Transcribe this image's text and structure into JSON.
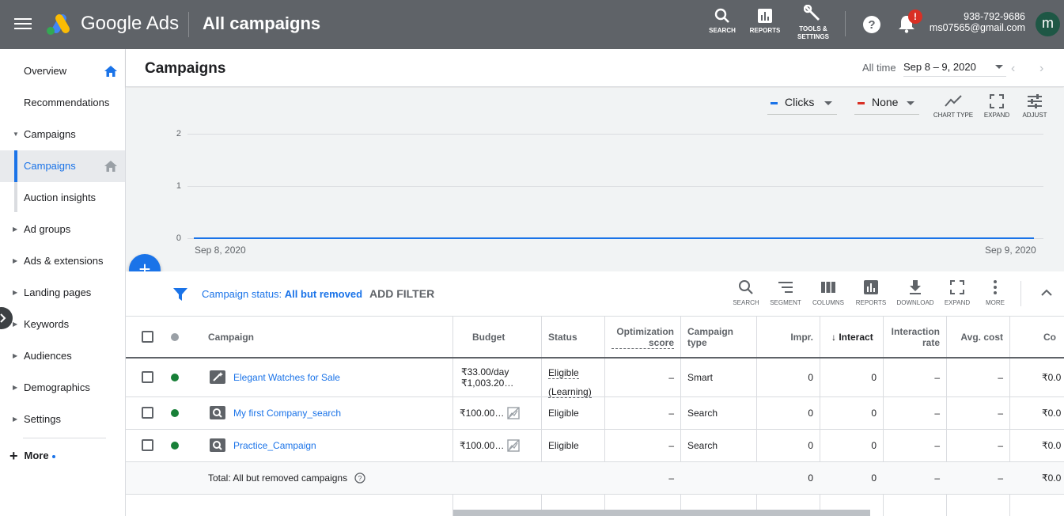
{
  "topbar": {
    "brand": "Google Ads",
    "page_title": "All campaigns",
    "tools": {
      "search": "SEARCH",
      "reports": "REPORTS",
      "tools_line1": "TOOLS &",
      "tools_line2": "SETTINGS"
    },
    "notification_badge": "!",
    "account_phone": "938-792-9686",
    "account_email": "ms07565@gmail.com",
    "avatar_letter": "m"
  },
  "sidebar": {
    "items": [
      {
        "label": "Overview"
      },
      {
        "label": "Recommendations"
      },
      {
        "label": "Campaigns"
      },
      {
        "label": "Campaigns"
      },
      {
        "label": "Auction insights"
      },
      {
        "label": "Ad groups"
      },
      {
        "label": "Ads & extensions"
      },
      {
        "label": "Landing pages"
      },
      {
        "label": "Keywords"
      },
      {
        "label": "Audiences"
      },
      {
        "label": "Demographics"
      },
      {
        "label": "Settings"
      }
    ],
    "more_label": "More"
  },
  "header": {
    "title": "Campaigns",
    "all_time_label": "All time",
    "date_range": "Sep 8 – 9, 2020"
  },
  "chart_controls": {
    "metric1": "Clicks",
    "metric2": "None",
    "chart_type": "CHART TYPE",
    "expand": "EXPAND",
    "adjust": "ADJUST",
    "colors": {
      "metric1": "#1a73e8",
      "metric2": "#d93025"
    }
  },
  "chart_data": {
    "type": "line",
    "x": [
      "Sep 8, 2020",
      "Sep 9, 2020"
    ],
    "series": [
      {
        "name": "Clicks",
        "values": [
          0,
          0
        ]
      }
    ],
    "yticks": [
      "2",
      "1",
      "0"
    ],
    "ylim": [
      0,
      2
    ],
    "grid": true
  },
  "filter": {
    "prefix": "Campaign status: ",
    "value": "All but removed",
    "add_filter": "ADD FILTER"
  },
  "table_tools": [
    "SEARCH",
    "SEGMENT",
    "COLUMNS",
    "REPORTS",
    "DOWNLOAD",
    "EXPAND",
    "MORE"
  ],
  "table": {
    "headers": {
      "campaign": "Campaign",
      "budget": "Budget",
      "status": "Status",
      "opt_score_1": "Optimization",
      "opt_score_2": "score",
      "camp_type_1": "Campaign",
      "camp_type_2": "type",
      "impr": "Impr.",
      "interactions": "Interact",
      "int_rate_1": "Interaction",
      "int_rate_2": "rate",
      "avg_cost": "Avg. cost",
      "cost": "Co"
    },
    "rows": [
      {
        "campaign": "Elegant Watches for Sale",
        "budget_1": "₹33.00/day",
        "budget_2": "₹1,003.20…",
        "status_1": "Eligible",
        "status_2": "(Learning)",
        "opt": "–",
        "type": "Smart",
        "impr": "0",
        "interactions": "0",
        "rate": "–",
        "avg_cost": "–",
        "cost": "₹0.0"
      },
      {
        "campaign": "My first Company_search",
        "budget_1": "₹100.00…",
        "status_1": "Eligible",
        "opt": "–",
        "type": "Search",
        "impr": "0",
        "interactions": "0",
        "rate": "–",
        "avg_cost": "–",
        "cost": "₹0.0"
      },
      {
        "campaign": "Practice_Campaign",
        "budget_1": "₹100.00…",
        "status_1": "Eligible",
        "opt": "–",
        "type": "Search",
        "impr": "0",
        "interactions": "0",
        "rate": "–",
        "avg_cost": "–",
        "cost": "₹0.0"
      }
    ],
    "total": {
      "label": "Total: All but removed campaigns",
      "opt": "–",
      "impr": "0",
      "interactions": "0",
      "rate": "–",
      "avg_cost": "–",
      "cost": "₹0.0"
    }
  }
}
